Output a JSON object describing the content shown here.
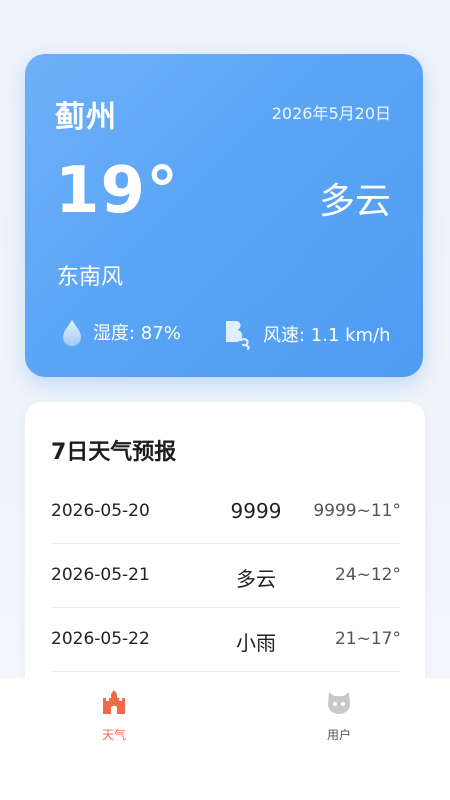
{
  "current": {
    "city": "蓟州",
    "date": "2026年5月20日",
    "temperature": "19°",
    "condition": "多云",
    "wind_direction": "东南风",
    "humidity": "湿度: 87%",
    "wind_speed": "风速: 1.1 km/h"
  },
  "forecast": {
    "title": "7日天气预报",
    "rows": [
      {
        "date": "2026-05-20",
        "condition": "9999",
        "temp": "9999~11°"
      },
      {
        "date": "2026-05-21",
        "condition": "多云",
        "temp": "24~12°"
      },
      {
        "date": "2026-05-22",
        "condition": "小雨",
        "temp": "21~17°"
      }
    ]
  },
  "tabbar": {
    "weather_label": "天气",
    "user_label": "用户"
  },
  "colors": {
    "card_blue": "#5aa4f5",
    "active_tab": "#f06a4a",
    "inactive_tab": "#c8c8c8"
  },
  "icons": {
    "humidity": "water-drop-icon",
    "wind": "wind-icon",
    "weather_tab": "castle-icon",
    "user_tab": "cat-face-icon"
  }
}
